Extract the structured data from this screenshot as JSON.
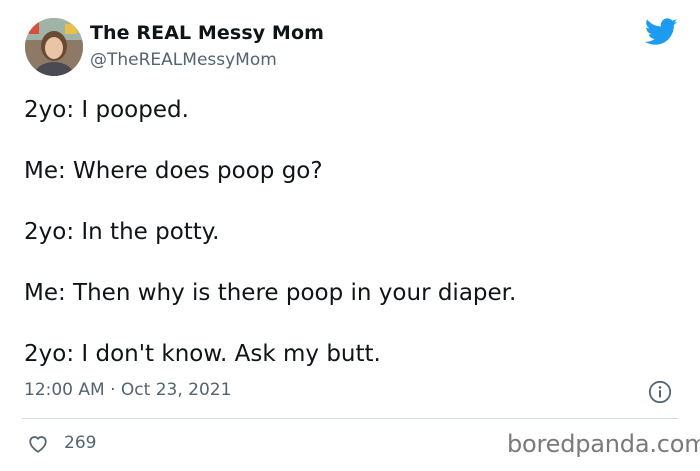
{
  "author": {
    "display_name": "The REAL Messy Mom",
    "handle": "@TheREALMessyMom",
    "avatar_icon": "profile-photo"
  },
  "tweet": {
    "lines": [
      "2yo: I pooped.",
      "Me: Where does poop go?",
      "2yo: In the potty.",
      "Me: Then why is there poop in your diaper.",
      "2yo: I don't know. Ask my butt."
    ],
    "timestamp": "12:00 AM · Oct 23, 2021",
    "like_count": "269"
  },
  "icons": {
    "platform": "twitter-bird-icon",
    "info": "info-icon",
    "like": "heart-icon"
  },
  "watermark": "boredpanda.com",
  "colors": {
    "twitter_blue": "#1d9bf0",
    "text_primary": "#0f1419",
    "text_secondary": "#536471",
    "divider": "#cfd9de"
  }
}
